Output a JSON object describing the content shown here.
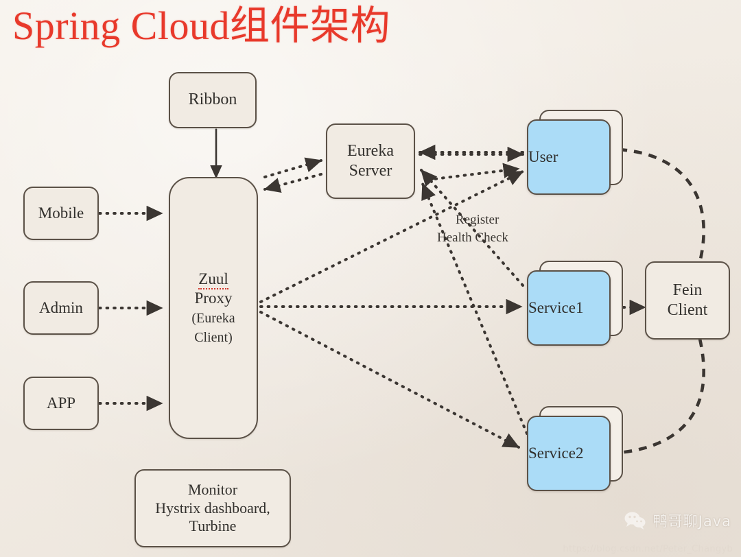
{
  "slide": {
    "title": "Spring Cloud组件架构",
    "title_color": "#e8392b",
    "background_color": "#f3ede6",
    "border_color": "#5b5147",
    "service_fill_color": "#abdcf7",
    "text_color": "#32302d"
  },
  "nodes": {
    "ribbon": {
      "label": "Ribbon"
    },
    "mobile": {
      "label": "Mobile"
    },
    "admin": {
      "label": "Admin"
    },
    "app": {
      "label": "APP"
    },
    "zuul": {
      "line1": "Zuul",
      "line2": "Proxy",
      "line3": "(Eureka",
      "line4": "Client)"
    },
    "monitor": {
      "line1": "Monitor",
      "line2": "Hystrix dashboard,",
      "line3": "Turbine"
    },
    "eureka_server": {
      "line1": "Eureka",
      "line2": "Server"
    },
    "user": {
      "label": "User"
    },
    "service1": {
      "label": "Service1"
    },
    "service2": {
      "label": "Service2"
    },
    "fein_client": {
      "line1": "Fein",
      "line2": "Client"
    }
  },
  "edge_labels": {
    "register": "Register",
    "health_check": "Health Check"
  },
  "watermark": {
    "brand": "鸭哥聊Java",
    "url": "https://blog.csdn.net/Peter_Changyb"
  }
}
